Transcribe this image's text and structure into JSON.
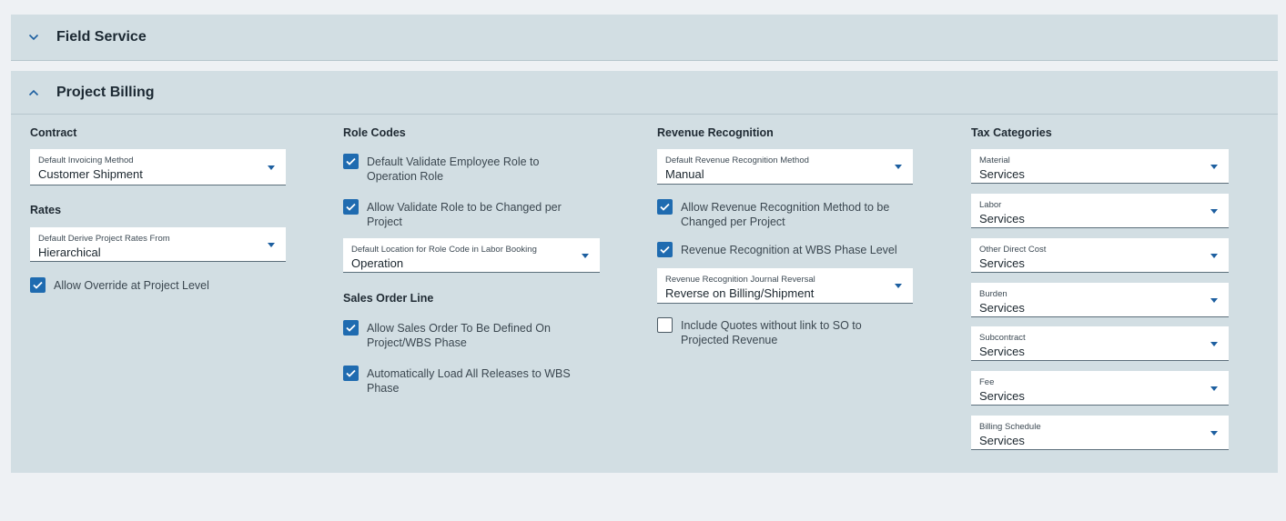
{
  "panels": {
    "field_service": {
      "title": "Field Service",
      "expanded": false
    },
    "project_billing": {
      "title": "Project Billing",
      "expanded": true
    }
  },
  "contract": {
    "heading": "Contract",
    "default_invoicing": {
      "label": "Default Invoicing Method",
      "value": "Customer Shipment"
    },
    "rates_heading": "Rates",
    "default_rates": {
      "label": "Default Derive Project Rates From",
      "value": "Hierarchical"
    },
    "allow_override": {
      "label": "Allow Override at Project Level",
      "checked": true
    }
  },
  "role_codes": {
    "heading": "Role Codes",
    "validate_employee_role": {
      "label": "Default Validate Employee Role to Operation Role",
      "checked": true
    },
    "allow_validate_change": {
      "label": "Allow Validate Role to be Changed per Project",
      "checked": true
    },
    "default_location": {
      "label": "Default Location for Role Code in Labor Booking",
      "value": "Operation"
    },
    "sales_heading": "Sales Order Line",
    "allow_sales_order": {
      "label": "Allow Sales Order To Be Defined On Project/WBS Phase",
      "checked": true
    },
    "auto_load_releases": {
      "label": "Automatically Load All Releases to WBS Phase",
      "checked": true
    }
  },
  "revenue": {
    "heading": "Revenue Recognition",
    "default_method": {
      "label": "Default Revenue Recognition Method",
      "value": "Manual"
    },
    "allow_method_change": {
      "label": "Allow Revenue Recognition Method to be Changed per Project",
      "checked": true
    },
    "wbs_phase_level": {
      "label": "Revenue Recognition at WBS Phase Level",
      "checked": true
    },
    "journal_reversal": {
      "label": "Revenue Recognition Journal Reversal",
      "value": "Reverse on Billing/Shipment"
    },
    "include_quotes": {
      "label": "Include Quotes without link to SO to Projected Revenue",
      "checked": false
    }
  },
  "tax": {
    "heading": "Tax Categories",
    "items": [
      {
        "label": "Material",
        "value": "Services"
      },
      {
        "label": "Labor",
        "value": "Services"
      },
      {
        "label": "Other Direct Cost",
        "value": "Services"
      },
      {
        "label": "Burden",
        "value": "Services"
      },
      {
        "label": "Subcontract",
        "value": "Services"
      },
      {
        "label": "Fee",
        "value": "Services"
      },
      {
        "label": "Billing Schedule",
        "value": "Services"
      }
    ]
  },
  "colors": {
    "accent": "#1f6bb0",
    "panel": "#d2dee3",
    "background": "#eef1f4"
  },
  "icons": {
    "collapsed": "chevron-down-icon",
    "expanded": "chevron-up-icon",
    "dropdown": "caret-down-icon",
    "check": "check-icon"
  }
}
